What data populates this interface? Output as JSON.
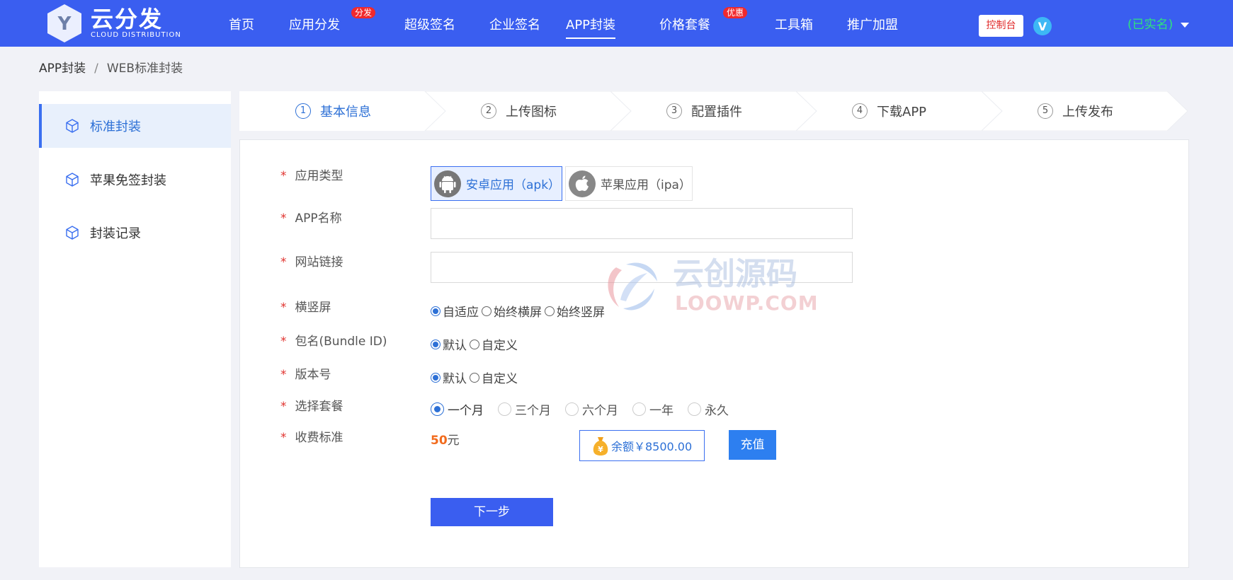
{
  "brand": {
    "logo_letter": "Y",
    "name": "云分发",
    "subtitle": "CLOUD DISTRIBUTION"
  },
  "nav": {
    "items": [
      {
        "label": "首页"
      },
      {
        "label": "应用分发",
        "badge": "分发"
      },
      {
        "label": "超级签名"
      },
      {
        "label": "企业签名"
      },
      {
        "label": "APP封装",
        "active": true
      },
      {
        "label": "价格套餐",
        "badge": "优惠"
      },
      {
        "label": "工具箱"
      },
      {
        "label": "推广加盟"
      }
    ],
    "console_label": "控制台",
    "vip_letter": "V",
    "user_status": "(已实名)"
  },
  "breadcrumb": {
    "parent": "APP封装",
    "separator": "/",
    "current": "WEB标准封装"
  },
  "sidebar": {
    "items": [
      {
        "label": "标准封装",
        "active": true
      },
      {
        "label": "苹果免签封装"
      },
      {
        "label": "封装记录"
      }
    ]
  },
  "steps": [
    {
      "num": "1",
      "label": "基本信息",
      "active": true
    },
    {
      "num": "2",
      "label": "上传图标"
    },
    {
      "num": "3",
      "label": "配置插件"
    },
    {
      "num": "4",
      "label": "下载APP"
    },
    {
      "num": "5",
      "label": "上传发布"
    }
  ],
  "form": {
    "required_mark": "*",
    "app_type": {
      "label": "应用类型",
      "options": [
        "安卓应用（apk）",
        "苹果应用（ipa）"
      ],
      "selected": "安卓应用（apk）"
    },
    "app_name": {
      "label": "APP名称",
      "value": "",
      "placeholder": ""
    },
    "site_url": {
      "label": "网站链接",
      "value": "",
      "placeholder": ""
    },
    "orientation": {
      "label": "横竖屏",
      "options": [
        "自适应",
        "始终横屏",
        "始终竖屏"
      ],
      "selected": "自适应"
    },
    "bundle_id": {
      "label": "包名(Bundle ID)",
      "options": [
        "默认",
        "自定义"
      ],
      "selected": "默认"
    },
    "version": {
      "label": "版本号",
      "options": [
        "默认",
        "自定义"
      ],
      "selected": "默认"
    },
    "plan": {
      "label": "选择套餐",
      "options": [
        "一个月",
        "三个月",
        "六个月",
        "一年",
        "永久"
      ],
      "selected": "一个月"
    },
    "fee": {
      "label": "收费标准",
      "amount": "50",
      "unit": "元",
      "balance_text": "余额￥8500.00",
      "bag_symbol": "¥",
      "recharge_label": "充值"
    },
    "next_label": "下一步"
  },
  "watermark": {
    "cn": "云创源码",
    "en": "LOOWP.COM"
  },
  "colors": {
    "header_bg": "#3a5ef0",
    "accent": "#2d70d6",
    "status_green": "#2fe27e",
    "badge_red": "#f0292d",
    "fee_orange": "#f26b1d"
  }
}
